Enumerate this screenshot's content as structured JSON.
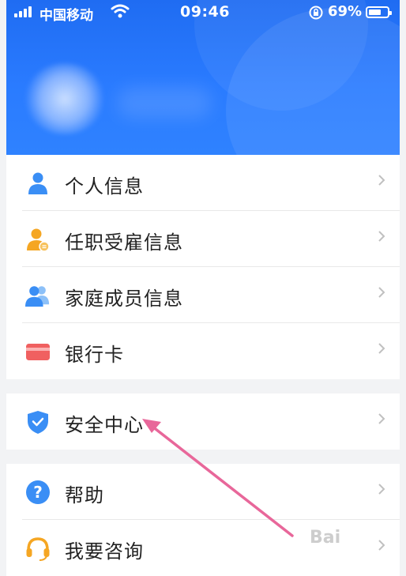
{
  "status_bar": {
    "carrier": "中国移动",
    "time": "09:46",
    "battery_percent": "69%",
    "battery_level": 0.69
  },
  "menu": {
    "group1": [
      {
        "label": "个人信息",
        "icon": "person-icon"
      },
      {
        "label": "任职受雇信息",
        "icon": "employee-icon"
      },
      {
        "label": "家庭成员信息",
        "icon": "family-icon"
      },
      {
        "label": "银行卡",
        "icon": "bank-card-icon"
      }
    ],
    "group2": [
      {
        "label": "安全中心",
        "icon": "shield-icon"
      }
    ],
    "group3": [
      {
        "label": "帮助",
        "icon": "help-icon"
      },
      {
        "label": "我要咨询",
        "icon": "headset-icon"
      }
    ]
  },
  "watermark": "Bai",
  "colors": {
    "header_blue": "#2a7bff",
    "icon_blue": "#3a8ef5",
    "icon_orange": "#f5a623",
    "card_red": "#f06060",
    "annotation_pink": "#e8679a"
  }
}
